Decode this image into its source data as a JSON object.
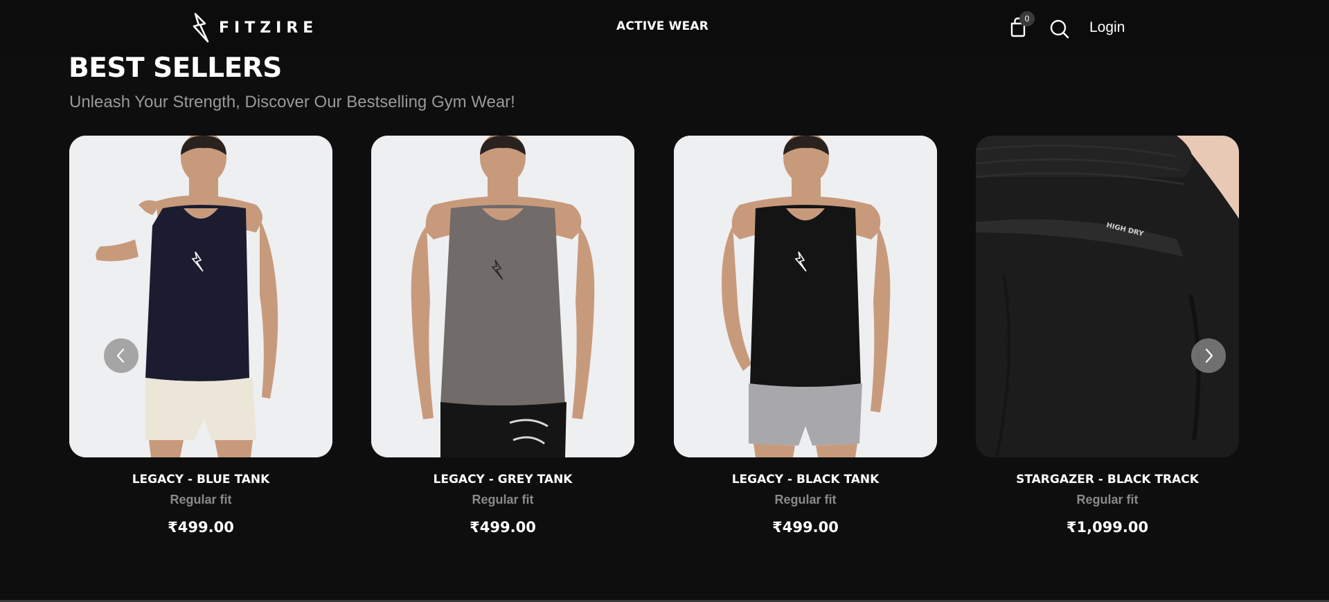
{
  "header": {
    "brand": "FITZIRE",
    "logo_icon": "lightning-bolt-icon",
    "nav": [
      {
        "label": "ACTIVE WEAR"
      }
    ],
    "cart_count": "0",
    "cart_icon": "shopping-bag-icon",
    "search_icon": "search-icon",
    "login_label": "Login"
  },
  "section": {
    "title": "BEST SELLERS",
    "subtitle": "Unleash Your Strength, Discover Our Bestselling Gym Wear!"
  },
  "products": [
    {
      "name": "LEGACY - BLUE TANK",
      "fit": "Regular fit",
      "price": "₹499.00",
      "tank_color": "#1b1c30",
      "bottom_color": "#ece6d8"
    },
    {
      "name": "LEGACY - GREY TANK",
      "fit": "Regular fit",
      "price": "₹499.00",
      "tank_color": "#716b69",
      "bottom_color": "#151515"
    },
    {
      "name": "LEGACY - BLACK TANK",
      "fit": "Regular fit",
      "price": "₹499.00",
      "tank_color": "#141414",
      "bottom_color": "#a8a8aa"
    },
    {
      "name": "STARGAZER - BLACK TRACK",
      "fit": "Regular fit",
      "price": "₹1,099.00",
      "tank_color": "#1c1c1c",
      "bottom_color": "#1c1c1c",
      "print_text": "HIGH DRY"
    }
  ],
  "carousel": {
    "prev_icon": "chevron-left-icon",
    "next_icon": "chevron-right-icon"
  },
  "colors": {
    "background": "#0e0e0e",
    "text": "#ffffff",
    "muted": "#8a8a8a",
    "skin": "#c89a7c"
  }
}
